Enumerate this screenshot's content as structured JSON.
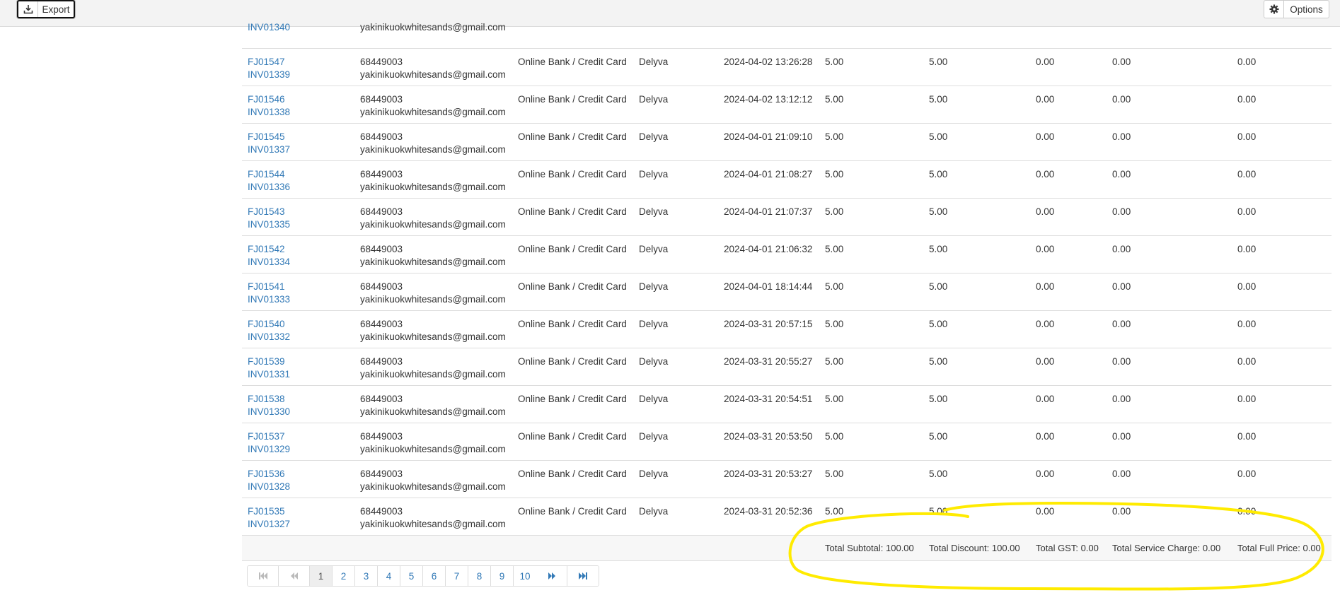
{
  "toolbar": {
    "export_label": "Export",
    "export_icon": "download-icon",
    "options_label": "Options",
    "options_icon": "gear-icon"
  },
  "partial_row": {
    "inv": "INV01340",
    "email": "yakinikuokwhitesands@gmail.com"
  },
  "rows": [
    {
      "fj": "FJ01547",
      "inv": "INV01339",
      "phone": "68449003",
      "email": "yakinikuokwhitesands@gmail.com",
      "payment": "Online Bank / Credit Card",
      "delivery": "Delyva",
      "date": "2024-04-02 13:26:28",
      "subtotal": "5.00",
      "discount": "5.00",
      "gst": "0.00",
      "service": "0.00",
      "full": "0.00"
    },
    {
      "fj": "FJ01546",
      "inv": "INV01338",
      "phone": "68449003",
      "email": "yakinikuokwhitesands@gmail.com",
      "payment": "Online Bank / Credit Card",
      "delivery": "Delyva",
      "date": "2024-04-02 13:12:12",
      "subtotal": "5.00",
      "discount": "5.00",
      "gst": "0.00",
      "service": "0.00",
      "full": "0.00"
    },
    {
      "fj": "FJ01545",
      "inv": "INV01337",
      "phone": "68449003",
      "email": "yakinikuokwhitesands@gmail.com",
      "payment": "Online Bank / Credit Card",
      "delivery": "Delyva",
      "date": "2024-04-01 21:09:10",
      "subtotal": "5.00",
      "discount": "5.00",
      "gst": "0.00",
      "service": "0.00",
      "full": "0.00"
    },
    {
      "fj": "FJ01544",
      "inv": "INV01336",
      "phone": "68449003",
      "email": "yakinikuokwhitesands@gmail.com",
      "payment": "Online Bank / Credit Card",
      "delivery": "Delyva",
      "date": "2024-04-01 21:08:27",
      "subtotal": "5.00",
      "discount": "5.00",
      "gst": "0.00",
      "service": "0.00",
      "full": "0.00"
    },
    {
      "fj": "FJ01543",
      "inv": "INV01335",
      "phone": "68449003",
      "email": "yakinikuokwhitesands@gmail.com",
      "payment": "Online Bank / Credit Card",
      "delivery": "Delyva",
      "date": "2024-04-01 21:07:37",
      "subtotal": "5.00",
      "discount": "5.00",
      "gst": "0.00",
      "service": "0.00",
      "full": "0.00"
    },
    {
      "fj": "FJ01542",
      "inv": "INV01334",
      "phone": "68449003",
      "email": "yakinikuokwhitesands@gmail.com",
      "payment": "Online Bank / Credit Card",
      "delivery": "Delyva",
      "date": "2024-04-01 21:06:32",
      "subtotal": "5.00",
      "discount": "5.00",
      "gst": "0.00",
      "service": "0.00",
      "full": "0.00"
    },
    {
      "fj": "FJ01541",
      "inv": "INV01333",
      "phone": "68449003",
      "email": "yakinikuokwhitesands@gmail.com",
      "payment": "Online Bank / Credit Card",
      "delivery": "Delyva",
      "date": "2024-04-01 18:14:44",
      "subtotal": "5.00",
      "discount": "5.00",
      "gst": "0.00",
      "service": "0.00",
      "full": "0.00"
    },
    {
      "fj": "FJ01540",
      "inv": "INV01332",
      "phone": "68449003",
      "email": "yakinikuokwhitesands@gmail.com",
      "payment": "Online Bank / Credit Card",
      "delivery": "Delyva",
      "date": "2024-03-31 20:57:15",
      "subtotal": "5.00",
      "discount": "5.00",
      "gst": "0.00",
      "service": "0.00",
      "full": "0.00"
    },
    {
      "fj": "FJ01539",
      "inv": "INV01331",
      "phone": "68449003",
      "email": "yakinikuokwhitesands@gmail.com",
      "payment": "Online Bank / Credit Card",
      "delivery": "Delyva",
      "date": "2024-03-31 20:55:27",
      "subtotal": "5.00",
      "discount": "5.00",
      "gst": "0.00",
      "service": "0.00",
      "full": "0.00"
    },
    {
      "fj": "FJ01538",
      "inv": "INV01330",
      "phone": "68449003",
      "email": "yakinikuokwhitesands@gmail.com",
      "payment": "Online Bank / Credit Card",
      "delivery": "Delyva",
      "date": "2024-03-31 20:54:51",
      "subtotal": "5.00",
      "discount": "5.00",
      "gst": "0.00",
      "service": "0.00",
      "full": "0.00"
    },
    {
      "fj": "FJ01537",
      "inv": "INV01329",
      "phone": "68449003",
      "email": "yakinikuokwhitesands@gmail.com",
      "payment": "Online Bank / Credit Card",
      "delivery": "Delyva",
      "date": "2024-03-31 20:53:50",
      "subtotal": "5.00",
      "discount": "5.00",
      "gst": "0.00",
      "service": "0.00",
      "full": "0.00"
    },
    {
      "fj": "FJ01536",
      "inv": "INV01328",
      "phone": "68449003",
      "email": "yakinikuokwhitesands@gmail.com",
      "payment": "Online Bank / Credit Card",
      "delivery": "Delyva",
      "date": "2024-03-31 20:53:27",
      "subtotal": "5.00",
      "discount": "5.00",
      "gst": "0.00",
      "service": "0.00",
      "full": "0.00"
    },
    {
      "fj": "FJ01535",
      "inv": "INV01327",
      "phone": "68449003",
      "email": "yakinikuokwhitesands@gmail.com",
      "payment": "Online Bank / Credit Card",
      "delivery": "Delyva",
      "date": "2024-03-31 20:52:36",
      "subtotal": "5.00",
      "discount": "5.00",
      "gst": "0.00",
      "service": "0.00",
      "full": "0.00"
    }
  ],
  "totals": {
    "subtotal": "Total Subtotal: 100.00",
    "discount": "Total Discount: 100.00",
    "gst": "Total GST: 0.00",
    "service": "Total Service Charge: 0.00",
    "full": "Total Full Price: 0.00"
  },
  "pagination": {
    "first_icon": "first-page-icon",
    "prev_icon": "prev-page-icon",
    "next_icon": "next-page-icon",
    "last_icon": "last-page-icon",
    "pages": [
      "1",
      "2",
      "3",
      "4",
      "5",
      "6",
      "7",
      "8",
      "9",
      "10"
    ],
    "current": "1"
  },
  "colors": {
    "link": "#337ab7",
    "highlight": "#ffeb00"
  }
}
